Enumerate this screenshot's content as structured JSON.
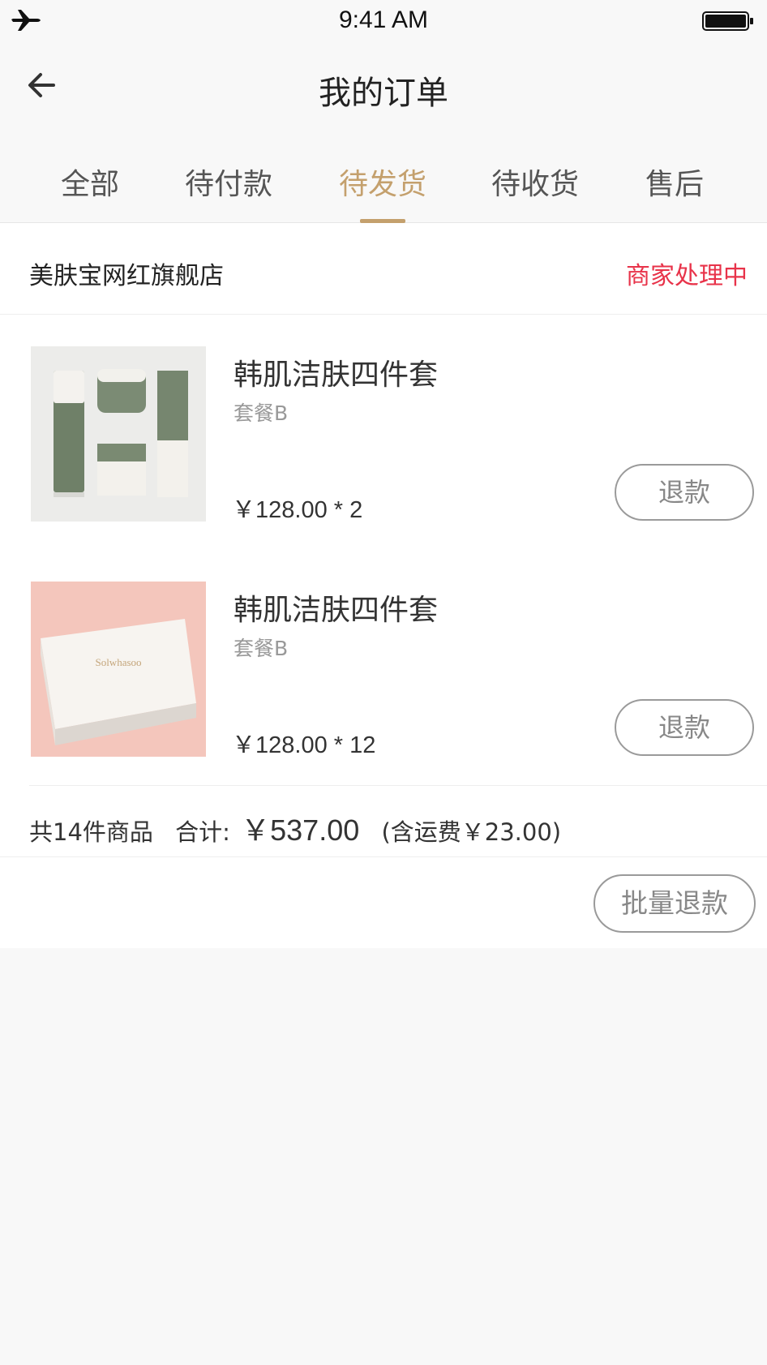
{
  "status_bar": {
    "time": "9:41 AM",
    "left_icon": "airplane-icon",
    "right_icon": "battery-icon"
  },
  "nav": {
    "back_icon": "arrow-left-icon",
    "title": "我的订单"
  },
  "tabs": [
    {
      "label": "全部",
      "active": false
    },
    {
      "label": "待付款",
      "active": false
    },
    {
      "label": "待发货",
      "active": true
    },
    {
      "label": "待收货",
      "active": false
    },
    {
      "label": "售后",
      "active": false
    }
  ],
  "order": {
    "store_name": "美肤宝网红旗舰店",
    "status": "商家处理中",
    "items": [
      {
        "title": "韩肌洁肤四件套",
        "variant": "套餐B",
        "price_line": "￥128.00 * 2",
        "refund_label": "退款"
      },
      {
        "title": "韩肌洁肤四件套",
        "variant": "套餐B",
        "price_line": "￥128.00 * 12",
        "refund_label": "退款"
      }
    ],
    "summary": {
      "count_text": "共14件商品",
      "total_label": "合计:",
      "total_value": "￥537.00",
      "shipping_text": "(含运费￥23.00)"
    },
    "batch_refund_label": "批量退款",
    "product_box_brand": "Solwhasoo"
  },
  "colors": {
    "accent": "#c4a06d",
    "status_red": "#e8334a",
    "background": "#f8f8f8"
  }
}
